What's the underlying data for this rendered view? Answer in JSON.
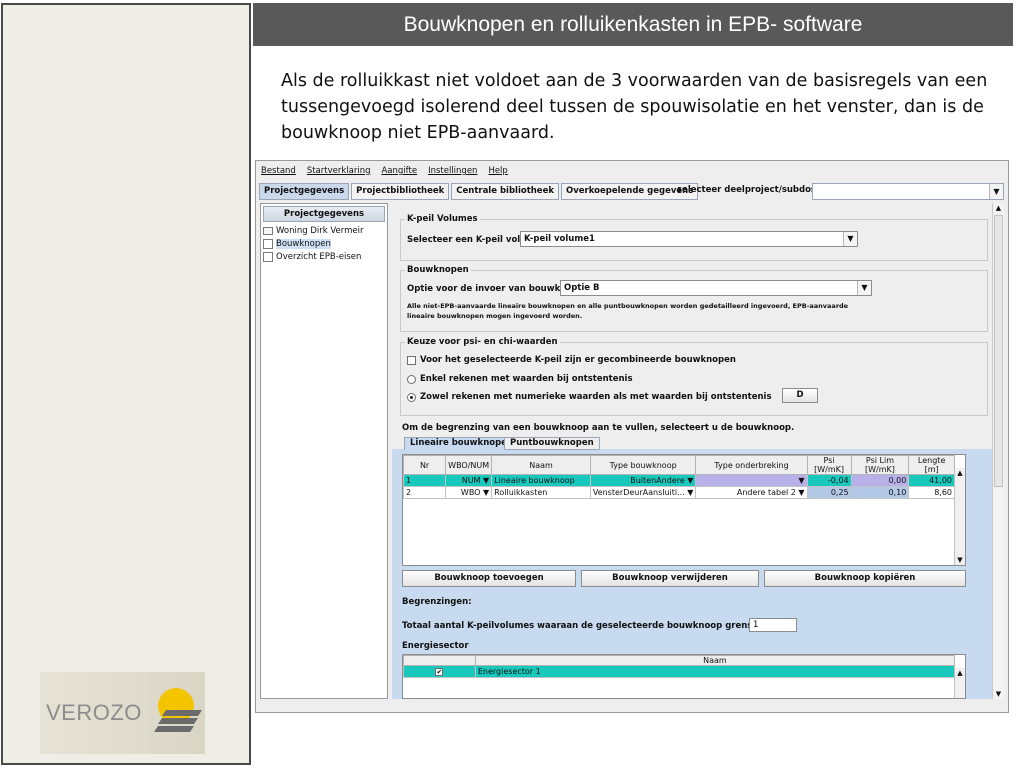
{
  "slide": {
    "title": "Bouwknopen en rolluikenkasten in EPB- software",
    "intro": "Als de rolluikkast niet voldoet aan de 3 voorwaarden van de basisregels van een tussengevoegd isolerend deel tussen de spouwisolatie en het venster, dan is de bouwknoop niet EPB-aanvaard.",
    "logo_text": "VEROZO"
  },
  "app": {
    "menu": [
      "Bestand",
      "Startverklaring",
      "Aangifte",
      "Instellingen",
      "Help"
    ],
    "tabs": [
      "Projectgegevens",
      "Projectbibliotheek",
      "Centrale bibliotheek",
      "Overkoepelende gegevens"
    ],
    "subdossier_label": "selecteer deelproject/subdossier:",
    "subdossier_value": "",
    "tree": {
      "header": "Projectgegevens",
      "items": [
        "Woning Dirk Vermeir",
        "Bouwknopen",
        "Overzicht EPB-eisen"
      ]
    },
    "kpeil": {
      "group_title": "K-peil Volumes",
      "label": "Selecteer een K-peil volume:",
      "value": "K-peil volume1"
    },
    "bouwknopen": {
      "group_title": "Bouwknopen",
      "label": "Optie voor de invoer van bouwknopen:",
      "value": "Optie B",
      "note": "Alle niet-EPB-aanvaarde lineaire bouwknopen en alle puntbouwknopen worden gedetailleerd ingevoerd, EPB-aanvaarde lineaire bouwknopen mogen ingevoerd worden."
    },
    "keuze": {
      "group_title": "Keuze voor psi- en chi-waarden",
      "checkbox": "Voor het geselecteerde K-peil zijn er gecombineerde bouwknopen",
      "radio1": "Enkel rekenen met waarden bij ontstentenis",
      "radio2": "Zowel rekenen met numerieke waarden als met waarden bij ontstentenis",
      "d_button": "D"
    },
    "instruction": "Om de begrenzing van een bouwknoop aan te vullen, selecteert u de bouwknoop.",
    "subtabs": [
      "Lineaire bouwknopen",
      "Puntbouwknopen"
    ],
    "table": {
      "columns": [
        "Nr",
        "WBO/NUM",
        "Naam",
        "Type bouwknoop",
        "Type onderbreking",
        "Psi [W/mK]",
        "Psi Lim [W/mK]",
        "Lengte [m]"
      ],
      "rows": [
        [
          "1",
          "NUM",
          "Lineaire bouwknoop",
          "BuitenAndere",
          "",
          "-0,04",
          "0,00",
          "41,00"
        ],
        [
          "2",
          "WBO",
          "Rolluikkasten",
          "VensterDeurAansluiti...",
          "Andere tabel 2",
          "0,25",
          "0,10",
          "8,60"
        ]
      ]
    },
    "buttons": [
      "Bouwknoop toevoegen",
      "Bouwknoop verwijderen",
      "Bouwknoop kopiëren"
    ],
    "begrenzingen_label": "Begrenzingen:",
    "totaal_label": "Totaal aantal K-peilvolumes waaraan de geselecteerde bouwknoop grenst:",
    "totaal_value": "1",
    "energiesector_label": "Energiesector",
    "energie_table": {
      "column": "Naam",
      "row": "Energiesector 1"
    }
  },
  "colors": {
    "title_bar": "#595959",
    "selected_row": "#18c8bd",
    "panel_blue": "#c7daef"
  }
}
